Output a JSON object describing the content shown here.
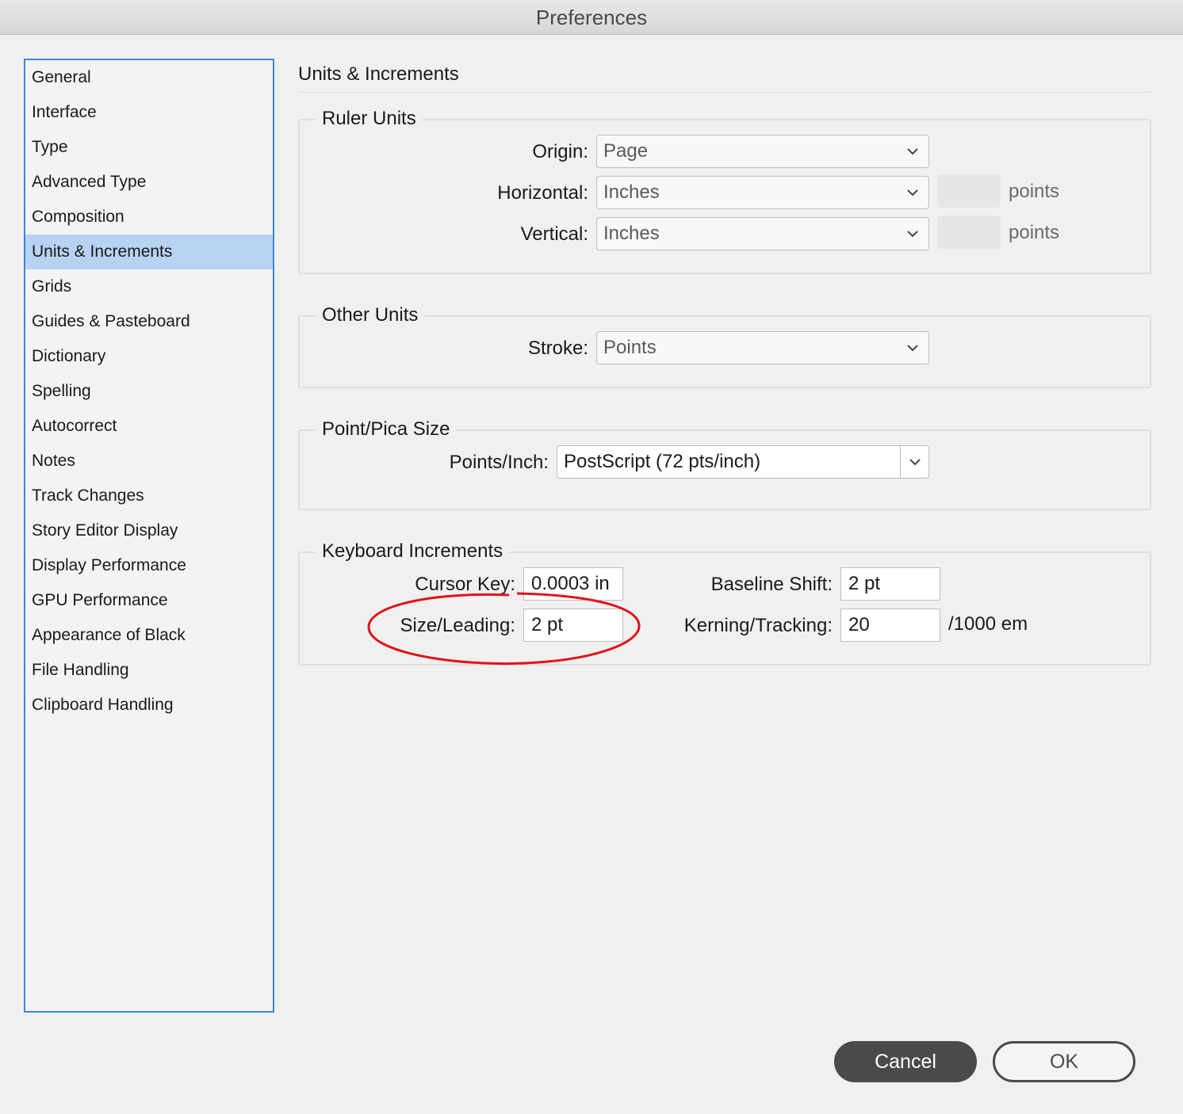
{
  "window": {
    "title": "Preferences"
  },
  "sidebar": {
    "items": [
      {
        "label": "General"
      },
      {
        "label": "Interface"
      },
      {
        "label": "Type"
      },
      {
        "label": "Advanced Type"
      },
      {
        "label": "Composition"
      },
      {
        "label": "Units & Increments",
        "selected": true
      },
      {
        "label": "Grids"
      },
      {
        "label": "Guides & Pasteboard"
      },
      {
        "label": "Dictionary"
      },
      {
        "label": "Spelling"
      },
      {
        "label": "Autocorrect"
      },
      {
        "label": "Notes"
      },
      {
        "label": "Track Changes"
      },
      {
        "label": "Story Editor Display"
      },
      {
        "label": "Display Performance"
      },
      {
        "label": "GPU Performance"
      },
      {
        "label": "Appearance of Black"
      },
      {
        "label": "File Handling"
      },
      {
        "label": "Clipboard Handling"
      }
    ]
  },
  "main": {
    "section_title": "Units & Increments",
    "ruler_units": {
      "legend": "Ruler Units",
      "origin": {
        "label": "Origin:",
        "value": "Page"
      },
      "horizontal": {
        "label": "Horizontal:",
        "value": "Inches",
        "unit": "points"
      },
      "vertical": {
        "label": "Vertical:",
        "value": "Inches",
        "unit": "points"
      }
    },
    "other_units": {
      "legend": "Other Units",
      "stroke": {
        "label": "Stroke:",
        "value": "Points"
      }
    },
    "point_pica": {
      "legend": "Point/Pica Size",
      "points_inch": {
        "label": "Points/Inch:",
        "value": "PostScript (72 pts/inch)"
      }
    },
    "keyboard_increments": {
      "legend": "Keyboard Increments",
      "cursor_key": {
        "label": "Cursor Key:",
        "value": "0.0003 in"
      },
      "baseline_shift": {
        "label": "Baseline Shift:",
        "value": "2 pt"
      },
      "size_leading": {
        "label": "Size/Leading:",
        "value": "2 pt"
      },
      "kerning_tracking": {
        "label": "Kerning/Tracking:",
        "value": "20",
        "unit": "/1000 em"
      }
    }
  },
  "footer": {
    "cancel_label": "Cancel",
    "ok_label": "OK"
  },
  "colors": {
    "selection": "#b7d3f1",
    "sidebar_border": "#3a87d9",
    "annotation": "#e0131a",
    "primary_button": "#4a4a4a"
  },
  "icons": {
    "dropdown": "chevron-down-icon"
  }
}
